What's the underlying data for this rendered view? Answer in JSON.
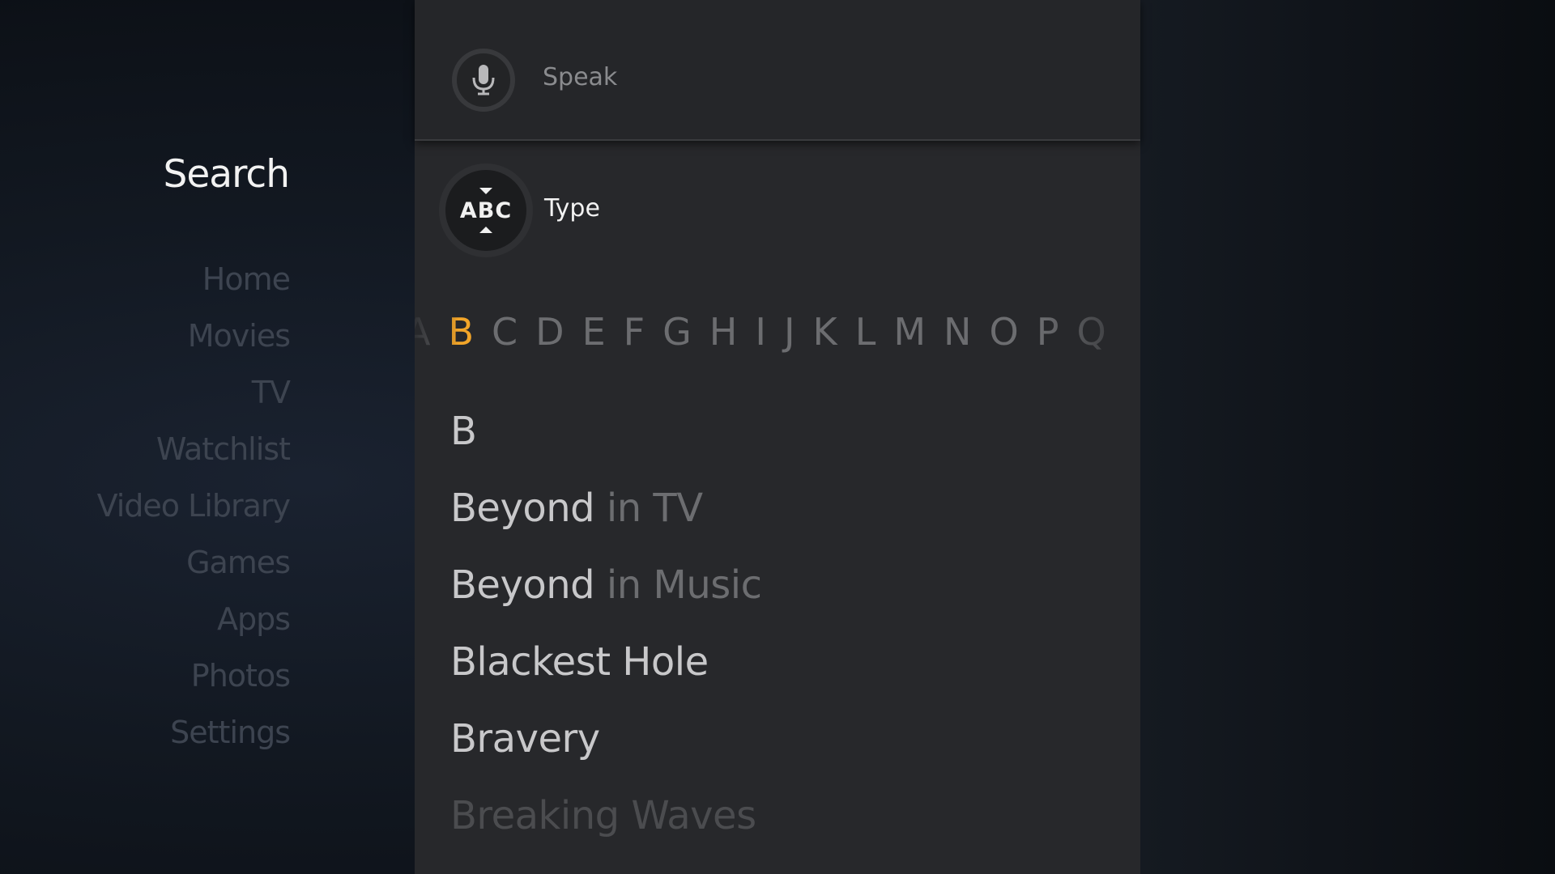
{
  "nav": {
    "title": "Search",
    "items": [
      {
        "label": "Home"
      },
      {
        "label": "Movies"
      },
      {
        "label": "TV"
      },
      {
        "label": "Watchlist"
      },
      {
        "label": "Video Library"
      },
      {
        "label": "Games"
      },
      {
        "label": "Apps"
      },
      {
        "label": "Photos"
      },
      {
        "label": "Settings"
      }
    ]
  },
  "speak": {
    "label": "Speak",
    "icon": "microphone-icon"
  },
  "type": {
    "label": "Type",
    "icon_text": "ABC",
    "icon": "keyboard-abc-icon"
  },
  "alphabet": {
    "letters": [
      "A",
      "B",
      "C",
      "D",
      "E",
      "F",
      "G",
      "H",
      "I",
      "J",
      "K",
      "L",
      "M",
      "N",
      "O",
      "P",
      "Q"
    ],
    "selected": "B",
    "accent_color": "#f2a529"
  },
  "results": {
    "query": "B",
    "items": [
      {
        "title": "Beyond",
        "context": " in TV"
      },
      {
        "title": "Beyond",
        "context": " in Music"
      },
      {
        "title": "Blackest Hole",
        "context": ""
      },
      {
        "title": "Bravery",
        "context": ""
      },
      {
        "title": "Breaking Waves",
        "context": ""
      }
    ]
  }
}
